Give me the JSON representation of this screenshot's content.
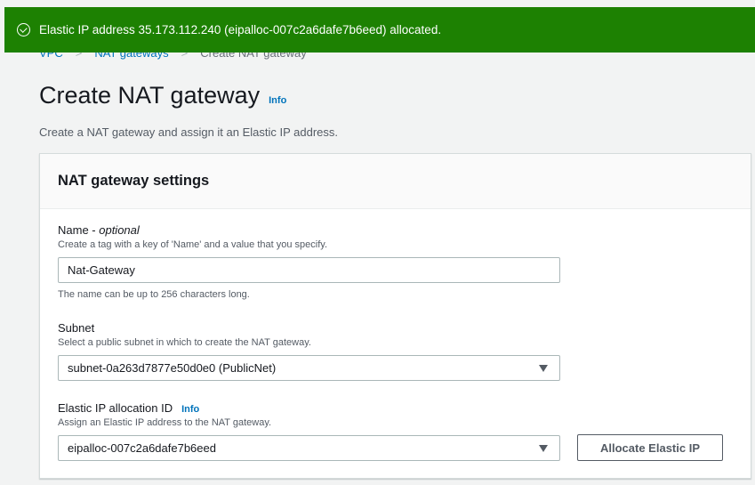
{
  "flash": {
    "message": "Elastic IP address 35.173.112.240 (eipalloc-007c2a6dafe7b6eed) allocated."
  },
  "breadcrumb": {
    "items": [
      "VPC",
      "NAT gateways",
      "Create NAT gateway"
    ]
  },
  "page": {
    "title": "Create NAT gateway",
    "info": "Info",
    "subtitle": "Create a NAT gateway and assign it an Elastic IP address."
  },
  "panel": {
    "title": "NAT gateway settings",
    "name": {
      "label": "Name - ",
      "optional": "optional",
      "description": "Create a tag with a key of 'Name' and a value that you specify.",
      "value": "Nat-Gateway",
      "hint": "The name can be up to 256 characters long."
    },
    "subnet": {
      "label": "Subnet",
      "description": "Select a public subnet in which to create the NAT gateway.",
      "value": "subnet-0a263d7877e50d0e0 (PublicNet)"
    },
    "eip": {
      "label": "Elastic IP allocation ID",
      "info": "Info",
      "description": "Assign an Elastic IP address to the NAT gateway.",
      "value": "eipalloc-007c2a6dafe7b6eed",
      "button": "Allocate Elastic IP"
    }
  },
  "colors": {
    "success": "#1d8102",
    "link": "#0073bb"
  },
  "icons": {
    "flash": "check-circle-icon",
    "dropdown": "caret-down-icon"
  }
}
